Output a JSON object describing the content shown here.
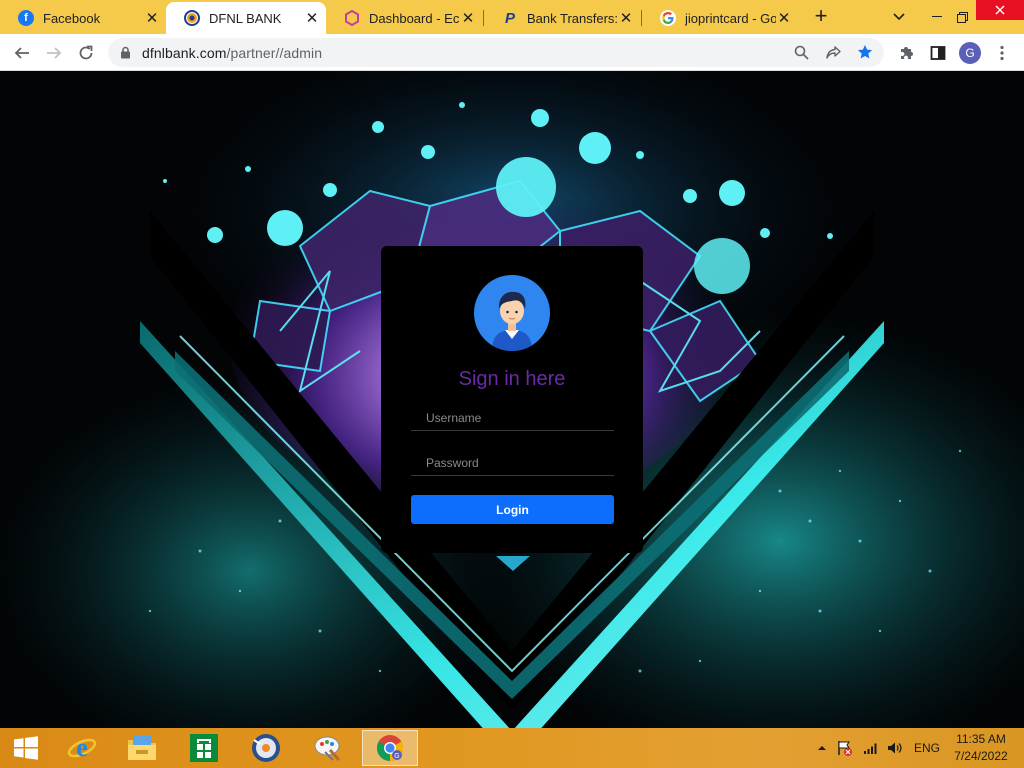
{
  "browser": {
    "tabs": [
      {
        "label": "Facebook",
        "icon": "facebook-icon",
        "active": false
      },
      {
        "label": "DFNL BANK",
        "icon": "dfnl-bank-icon",
        "active": true
      },
      {
        "label": "Dashboard - Ecuz",
        "icon": "dashboard-hexagon-icon",
        "active": false
      },
      {
        "label": "Bank Transfers: Pa",
        "icon": "paypal-icon",
        "active": false
      },
      {
        "label": "jioprintcard - Goo",
        "icon": "google-icon",
        "active": false
      }
    ],
    "new_tab": "+",
    "url_host": "dfnlbank.com",
    "url_path": "/partner//admin",
    "profile_initial": "G"
  },
  "login": {
    "title": "Sign in here",
    "username_placeholder": "Username",
    "password_placeholder": "Password",
    "button_label": "Login"
  },
  "taskbar": {
    "apps": [
      "windows-start-icon",
      "internet-explorer-icon",
      "file-explorer-icon",
      "windows-store-icon",
      "media-player-icon",
      "paint-icon",
      "chrome-icon"
    ],
    "language": "ENG",
    "time": "11:35 AM",
    "date": "7/24/2022"
  },
  "colors": {
    "tabstrip": "#f5c94a",
    "accent_cyan": "#2ee6e6",
    "login_button": "#0d6efd",
    "title_purple": "#6b2aa8",
    "taskbar": "#e0961e"
  }
}
